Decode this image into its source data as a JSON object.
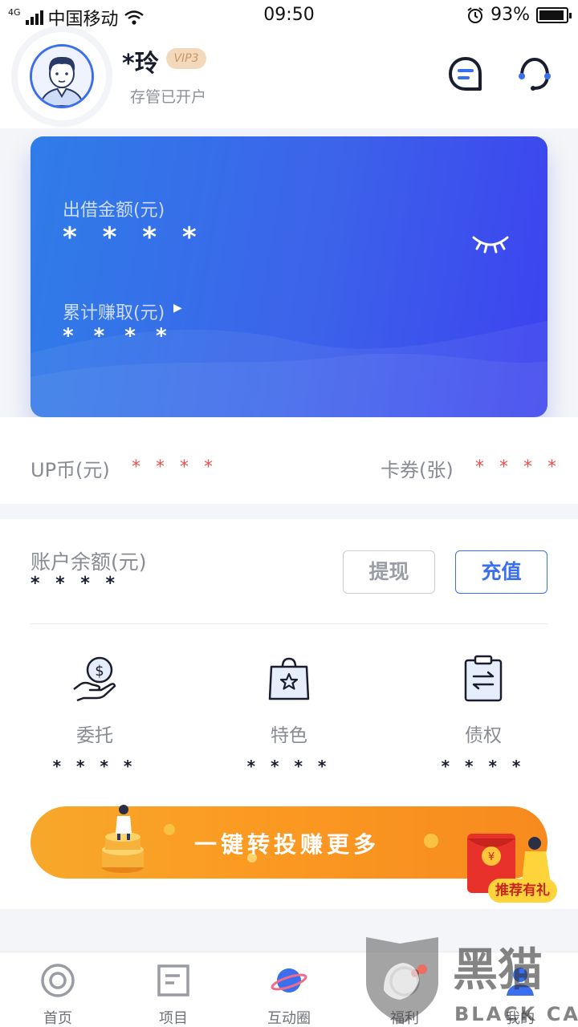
{
  "status_bar": {
    "network": "4G",
    "carrier": "中国移动",
    "time": "09:50",
    "battery_percent": "93%",
    "battery_level": 0.93
  },
  "header": {
    "username": "*玲",
    "vip_badge": "VIP3",
    "account_status": "存管已开户"
  },
  "card": {
    "lend_amount_label": "出借金额(元)",
    "lend_amount_value": "* * * *",
    "earned_label": "累计赚取(元)",
    "earned_value": "* * * *"
  },
  "assets_row": {
    "up_coin_label": "UP币(元)",
    "up_coin_value": "* * * *",
    "coupons_label": "卡券(张)",
    "coupons_value": "* * * *"
  },
  "balance": {
    "label": "账户余额(元)",
    "value": "* * * *",
    "withdraw_label": "提现",
    "recharge_label": "充值"
  },
  "features": [
    {
      "label": "委托",
      "value": "* * * *",
      "icon": "hand-dollar-icon"
    },
    {
      "label": "特色",
      "value": "* * * *",
      "icon": "star-bag-icon"
    },
    {
      "label": "债权",
      "value": "* * * *",
      "icon": "transfer-clipboard-icon"
    }
  ],
  "banner": {
    "text": "一键转投赚更多",
    "badge": "推荐有礼"
  },
  "tabs": [
    {
      "label": "首页",
      "icon": "home-circle-icon"
    },
    {
      "label": "项目",
      "icon": "project-square-icon"
    },
    {
      "label": "互动圈",
      "icon": "planet-icon"
    },
    {
      "label": "福利",
      "icon": "gift-icon"
    },
    {
      "label": "我的",
      "icon": "profile-icon"
    }
  ],
  "watermark": {
    "brand_cn": "黑猫",
    "brand_en": "BLACK CAT"
  },
  "colors": {
    "accent_blue": "#3a6ff0",
    "masked_red": "#f0504a",
    "banner_orange": "#fb9b22",
    "vip_gold": "#f3d9bb"
  }
}
